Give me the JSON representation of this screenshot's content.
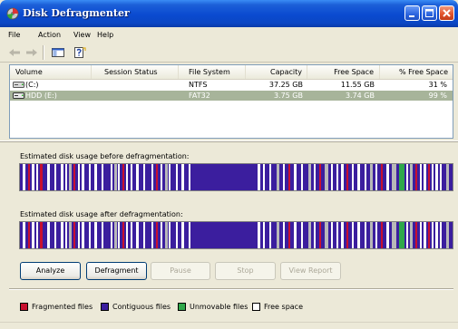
{
  "window": {
    "title": "Disk Defragmenter",
    "titlebar_color": "#0a4ad0",
    "buttons": [
      "minimize-icon",
      "maximize-icon",
      "close-icon"
    ]
  },
  "menu": [
    "File",
    "Action",
    "View",
    "Help"
  ],
  "toolbar": {
    "tools": [
      "back-arrow-icon",
      "forward-arrow-icon",
      "console-tree-icon",
      "help-icon"
    ]
  },
  "volume_table": {
    "columns": [
      "Volume",
      "Session Status",
      "File System",
      "Capacity",
      "Free Space",
      "% Free Space"
    ],
    "rows": [
      {
        "volume": "(C:)",
        "session_status": "",
        "file_system": "NTFS",
        "capacity": "37.25 GB",
        "free_space": "11.55 GB",
        "percent_free": "31 %",
        "selected": false
      },
      {
        "volume": "HDD (E:)",
        "session_status": "",
        "file_system": "FAT32",
        "capacity": "3.75 GB",
        "free_space": "3.74 GB",
        "percent_free": "99 %",
        "selected": true
      }
    ],
    "selection_color": "#a7b49a"
  },
  "analysis": {
    "before_label": "Estimated disk usage before defragmentation:",
    "after_label": "Estimated disk usage after defragmentation:"
  },
  "actions": [
    {
      "label": "Analyze",
      "enabled": true
    },
    {
      "label": "Defragment",
      "enabled": true
    },
    {
      "label": "Pause",
      "enabled": false
    },
    {
      "label": "Stop",
      "enabled": false
    },
    {
      "label": "View Report",
      "enabled": false
    }
  ],
  "legend": [
    {
      "label": "Fragmented files",
      "color": "#c8102e"
    },
    {
      "label": "Contiguous files",
      "color": "#3b1e9e"
    },
    {
      "label": "Unmovable files",
      "color": "#2fa84a"
    },
    {
      "label": "Free space",
      "color": "#ffffff"
    }
  ],
  "disk_colors": {
    "contiguous": "#3b1e9e",
    "free": "#ffffff",
    "fragmented": "#c8102e",
    "unmovable": "#2fa84a",
    "system": "#b8b8b8"
  }
}
